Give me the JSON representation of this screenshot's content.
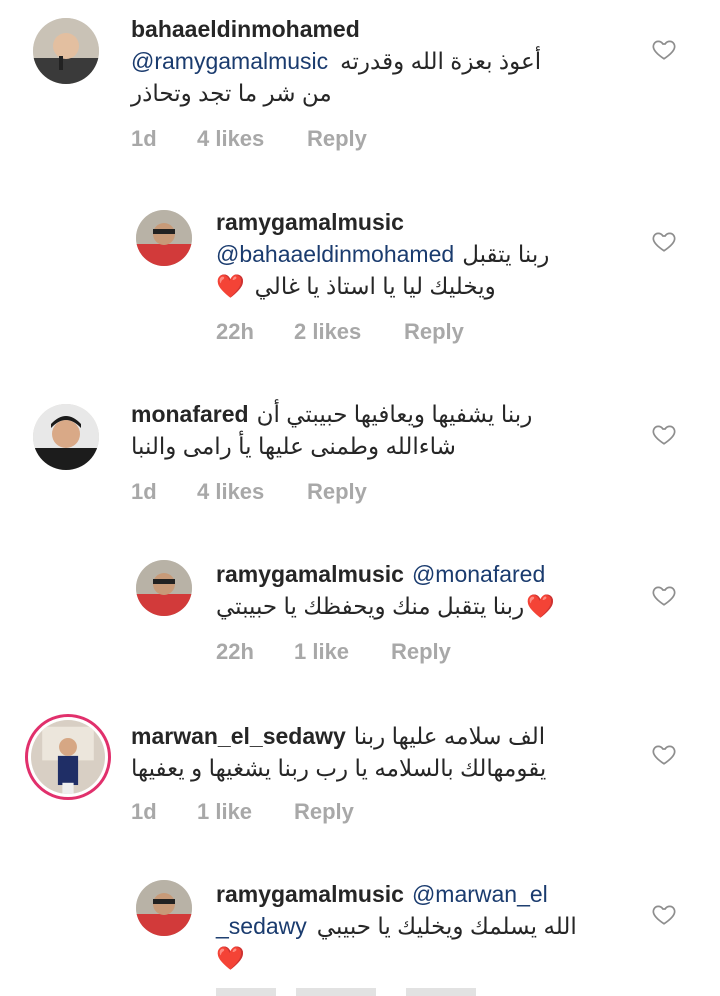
{
  "comments": [
    {
      "username": "bahaaeldinmohamed",
      "mention": "@ramygamalmusic",
      "text_line1": "أعوذ بعزة الله وقدرته",
      "text_line2": "من شر ما تجد وتحاذر",
      "time": "1d",
      "likes": "4 likes",
      "reply": "Reply"
    },
    {
      "username": "ramygamalmusic",
      "mention": "@bahaaeldinmohamed",
      "text_line1": "ربنا يتقبل",
      "text_line2": "ويخليك ليا يا استاذ يا غالي",
      "emoji": "❤️",
      "time": "22h",
      "likes": "2 likes",
      "reply": "Reply"
    },
    {
      "username": "monafared",
      "text_line1": "ربنا يشفيها ويعافيها حبيبتي أن",
      "text_line2": "شاءالله وطمنى عليها يأ رامى والنبا",
      "time": "1d",
      "likes": "4 likes",
      "reply": "Reply"
    },
    {
      "username": "ramygamalmusic",
      "mention": "@monafared",
      "text_line1": "ربنا يتقبل منك ويحفظك يا حبيبتي",
      "emoji": "❤️",
      "time": "22h",
      "likes": "1 like",
      "reply": "Reply"
    },
    {
      "username": "marwan_el_sedawy",
      "text_line1": "الف سلامه عليها ربنا",
      "text_line2": "يقومهالك بالسلامه يا رب  ربنا يشغيها و يعفيها",
      "time": "1d",
      "likes": "1 like",
      "reply": "Reply"
    },
    {
      "username": "ramygamalmusic",
      "mention_part1": "@marwan_el",
      "mention_part2": "_sedawy",
      "text_line2": "الله يسلمك ويخليك يا حبيبي",
      "emoji": "❤️"
    }
  ],
  "icons": {
    "like": "heart-outline-icon",
    "emoji_heart": "red-heart-emoji"
  },
  "colors": {
    "text": "#262626",
    "meta": "#a8a8a8",
    "mention": "#1a3b6e",
    "heart": "#ed1c24",
    "story_ring": "#e1306c"
  }
}
